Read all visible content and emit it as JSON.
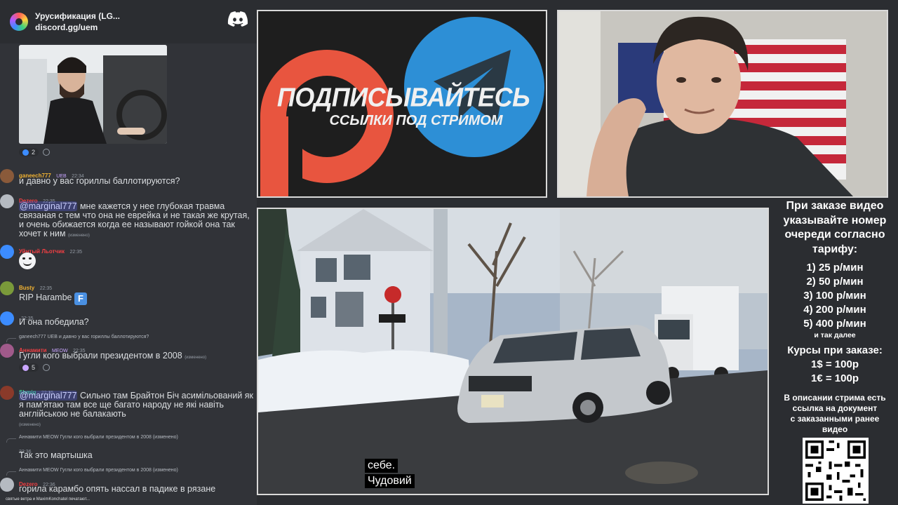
{
  "chat": {
    "server_name": "Урусификация (LG...",
    "invite": "discord.gg/uem",
    "image_reactions": {
      "count": "2"
    },
    "messages": [
      {
        "user": "ganeech777",
        "badge": "UEB",
        "time": "22:34",
        "text": "и давно у вас гориллы баллотируются?",
        "color": "#f0b232"
      },
      {
        "user": "Dezero",
        "time": "22:35",
        "mention": "@marginal777",
        "text": " мне кажется у нее глубокая травма связаная с тем что она не еврейка и не такая же крутая, и очень обижается когда ее называют гойкой она так хочет к ним",
        "edited": "(изменено)",
        "color": "#f23f43"
      },
      {
        "user": "Уйнтый Льотчик",
        "time": "22:35",
        "text": "",
        "color": "#f23f43"
      },
      {
        "user": "Busty",
        "time": "22:35",
        "text": "RIP Harambe",
        "emoji": "F",
        "color": "#f0b232"
      },
      {
        "user": "",
        "time": "22:35",
        "text": "И она победила?",
        "color": "#c9a6ff"
      },
      {
        "reply": "ganeech777 UEB и давно у вас гориллы баллотируются?",
        "user": "Аннамити",
        "badge": "MEOW",
        "time": "22:35",
        "text": "Гугли кого выбрали президентом в 2008",
        "edited": "(изменено)",
        "reactions": "5",
        "color": "#f23f43"
      },
      {
        "user": "Shmig",
        "time": "22:35",
        "mention": "@marginal777",
        "text": " Сильно там Брайтон Біч асимільований як я пам'ятаю там все ще багато народу не які навіть англійською не балакають",
        "edited": "(изменено)",
        "color": "#3cd27a"
      },
      {
        "reply": "Аннамити MEOW Гугли кого выбрали президентом в 2008 (изменено)",
        "user": "",
        "time": "22:36",
        "text": "Так это мартышка",
        "color": "#c9a6ff"
      },
      {
        "reply": "Аннамити MEOW Гугли кого выбрали президентом в 2008 (изменено)",
        "user": "Dezero",
        "time": "22:36",
        "text": "горила карамбо опять нассал в падике в рязане",
        "color": "#f23f43"
      }
    ],
    "typing": "святые ветра и MaximKonchatel печатают..."
  },
  "banner": {
    "title": "ПОДПИСЫВАЙТЕСЬ",
    "subtitle": "ССЫЛКИ ПОД СТРИМОМ",
    "patreon_color": "#e8553f",
    "telegram_color": "#2d8fd6"
  },
  "video": {
    "subtitle_line1": "себе.",
    "subtitle_line2": "Чудовий"
  },
  "info": {
    "heading": [
      "При заказе видео",
      "указывайте номер",
      "очереди согласно",
      "тарифу:"
    ],
    "prices": [
      "1) 25 р/мин",
      "2) 50 р/мин",
      "3) 100 р/мин",
      "4) 200 р/мин",
      "5) 400 р/мин"
    ],
    "prices_more": "и так далее",
    "rates_title": "Курсы при заказе:",
    "rates": [
      "1$ = 100р",
      "1€ = 100р"
    ],
    "note": [
      "В описании стрима есть",
      "ссылка на документ",
      "с заказанными ранее",
      "видео"
    ]
  }
}
